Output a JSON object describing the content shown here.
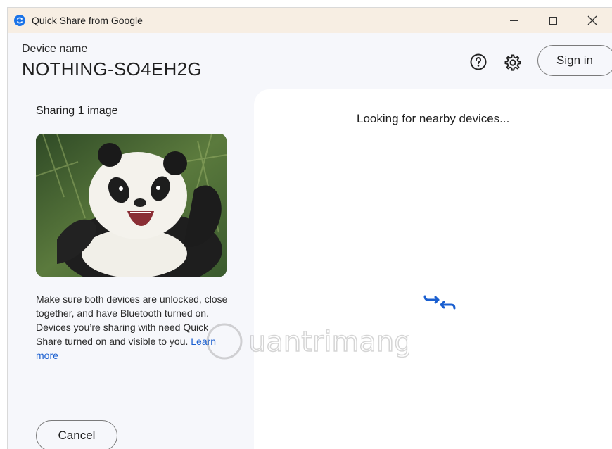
{
  "window": {
    "title": "Quick Share from Google",
    "controls": {
      "minimize": "—",
      "maximize": "☐",
      "close": "✕"
    }
  },
  "header": {
    "device_label": "Device name",
    "device_name": "NOTHING-SO4EH2G",
    "help_icon": "help-circle-icon",
    "settings_icon": "gear-icon",
    "sign_in_label": "Sign in"
  },
  "sharing": {
    "title": "Sharing 1 image",
    "preview_alt": "panda",
    "help_text": "Make sure both devices are unlocked, close together, and have Bluetooth turned on. Devices you’re sharing with need Quick Share turned on and visible to you.",
    "learn_more_label": "Learn more",
    "cancel_label": "Cancel"
  },
  "devices_panel": {
    "status_text": "Looking for nearby devices...",
    "status_icon": "transfer-arrows-icon"
  },
  "colors": {
    "titlebar_bg": "#f7eee3",
    "window_bg": "#f6f7fb",
    "accent": "#1a5fd0",
    "panel_bg": "#ffffff"
  }
}
